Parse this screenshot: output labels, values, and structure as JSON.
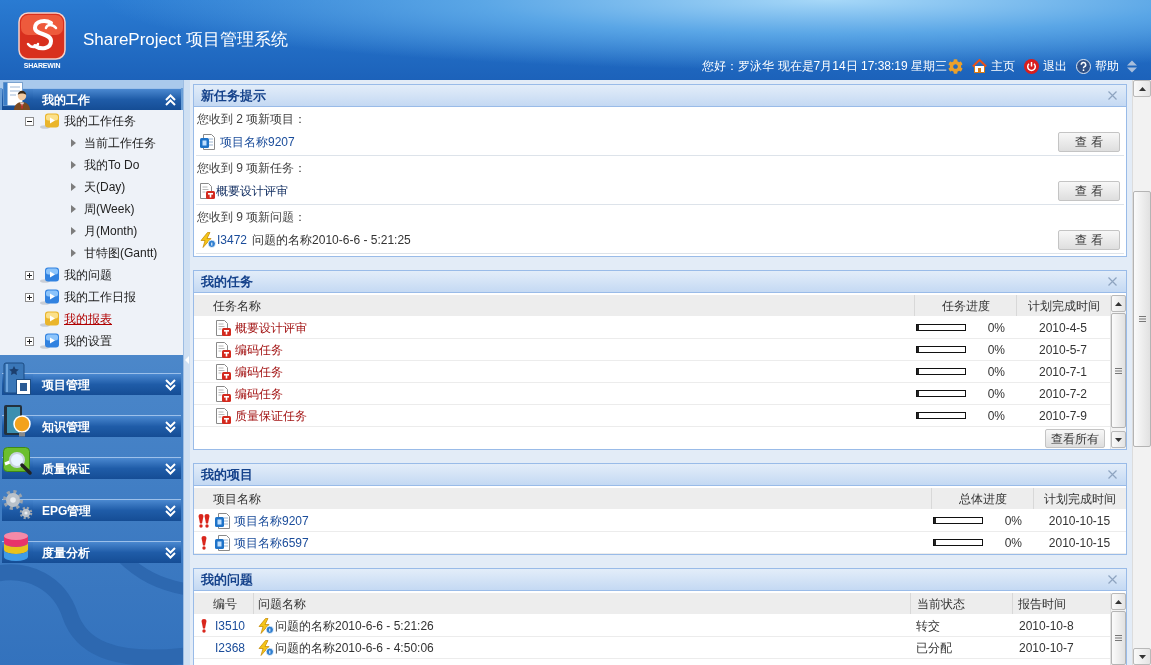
{
  "header": {
    "logo_text": "SHAREWIN",
    "title": "ShareProject 项目管理系统",
    "greeting": "您好：罗泳华 现在是7月14日 17:38:19 星期三",
    "links": [
      {
        "kind": "home",
        "label": "主页"
      },
      {
        "kind": "logout",
        "label": "退出"
      },
      {
        "kind": "help",
        "label": "帮助"
      }
    ]
  },
  "sidebar": {
    "sections": [
      {
        "title": "我的工作",
        "expanded": true,
        "tree": [
          {
            "label": "我的工作任务",
            "expanded": true,
            "selected": false,
            "children": [
              {
                "label": "当前工作任务",
                "selected": false
              },
              {
                "label": "我的To Do",
                "selected": false
              },
              {
                "label": "天(Day)",
                "selected": false
              },
              {
                "label": "周(Week)",
                "selected": false
              },
              {
                "label": "月(Month)",
                "selected": false
              },
              {
                "label": "甘特图(Gantt)",
                "selected": false
              }
            ]
          },
          {
            "label": "我的问题",
            "expanded": false,
            "selected": false
          },
          {
            "label": "我的工作日报",
            "expanded": false,
            "selected": false
          },
          {
            "label": "我的报表",
            "selected": true
          },
          {
            "label": "我的设置",
            "expanded": false,
            "selected": false
          }
        ]
      },
      {
        "title": "项目管理",
        "expanded": false
      },
      {
        "title": "知识管理",
        "expanded": false
      },
      {
        "title": "质量保证",
        "expanded": false
      },
      {
        "title": "EPG管理",
        "expanded": false
      },
      {
        "title": "度量分析",
        "expanded": false
      }
    ]
  },
  "notices": {
    "title": "新任务提示",
    "groups": [
      {
        "kind": "project",
        "message": "您收到 2 项新项目：",
        "name": "项目名称9207",
        "button": "查 看"
      },
      {
        "kind": "task",
        "message": "您收到 9 项新任务：",
        "name": "概要设计评审",
        "button": "查 看"
      },
      {
        "kind": "issue",
        "message": "您收到 9 项新问题：",
        "id": "I3472",
        "name": "问题的名称2010-6-6 - 5:21:25",
        "button": "查 看"
      }
    ]
  },
  "tasks": {
    "title": "我的任务",
    "columns": [
      "任务名称",
      "任务进度",
      "计划完成时间"
    ],
    "rows": [
      {
        "name": "概要设计评审",
        "level": 0,
        "reading": "0%",
        "due": "2010-4-5"
      },
      {
        "name": "编码任务",
        "level": 0,
        "reading": "0%",
        "due": "2010-5-7"
      },
      {
        "name": "编码任务",
        "level": 0,
        "reading": "0%",
        "due": "2010-7-1"
      },
      {
        "name": "编码任务",
        "level": 0,
        "reading": "0%",
        "due": "2010-7-2"
      },
      {
        "name": "质量保证任务",
        "level": 0,
        "reading": "0%",
        "due": "2010-7-9"
      }
    ],
    "button": "查看所有"
  },
  "projects": {
    "title": "我的项目",
    "columns": [
      "项目名称",
      "总体进度",
      "计划完成时间"
    ],
    "rows": [
      {
        "flagged": true,
        "urgent": true,
        "name": "项目名称9207",
        "level": 0,
        "reading": "0%",
        "due": "2010-10-15"
      },
      {
        "flagged": true,
        "urgent": false,
        "name": "项目名称6597",
        "level": 0,
        "reading": "0%",
        "due": "2010-10-15"
      }
    ]
  },
  "issues": {
    "title": "我的问题",
    "columns": [
      "编号",
      "问题名称",
      "当前状态",
      "报告时间"
    ],
    "rows": [
      {
        "flagged": true,
        "urgent": false,
        "id": "I3510",
        "name": "问题的名称2010-6-6 - 5:21:26",
        "status": "转交",
        "reported": "2010-10-8"
      },
      {
        "flagged": false,
        "urgent": false,
        "id": "I2368",
        "name": "问题的名称2010-6-6 - 4:50:06",
        "status": "已分配",
        "reported": "2010-10-7"
      }
    ]
  }
}
